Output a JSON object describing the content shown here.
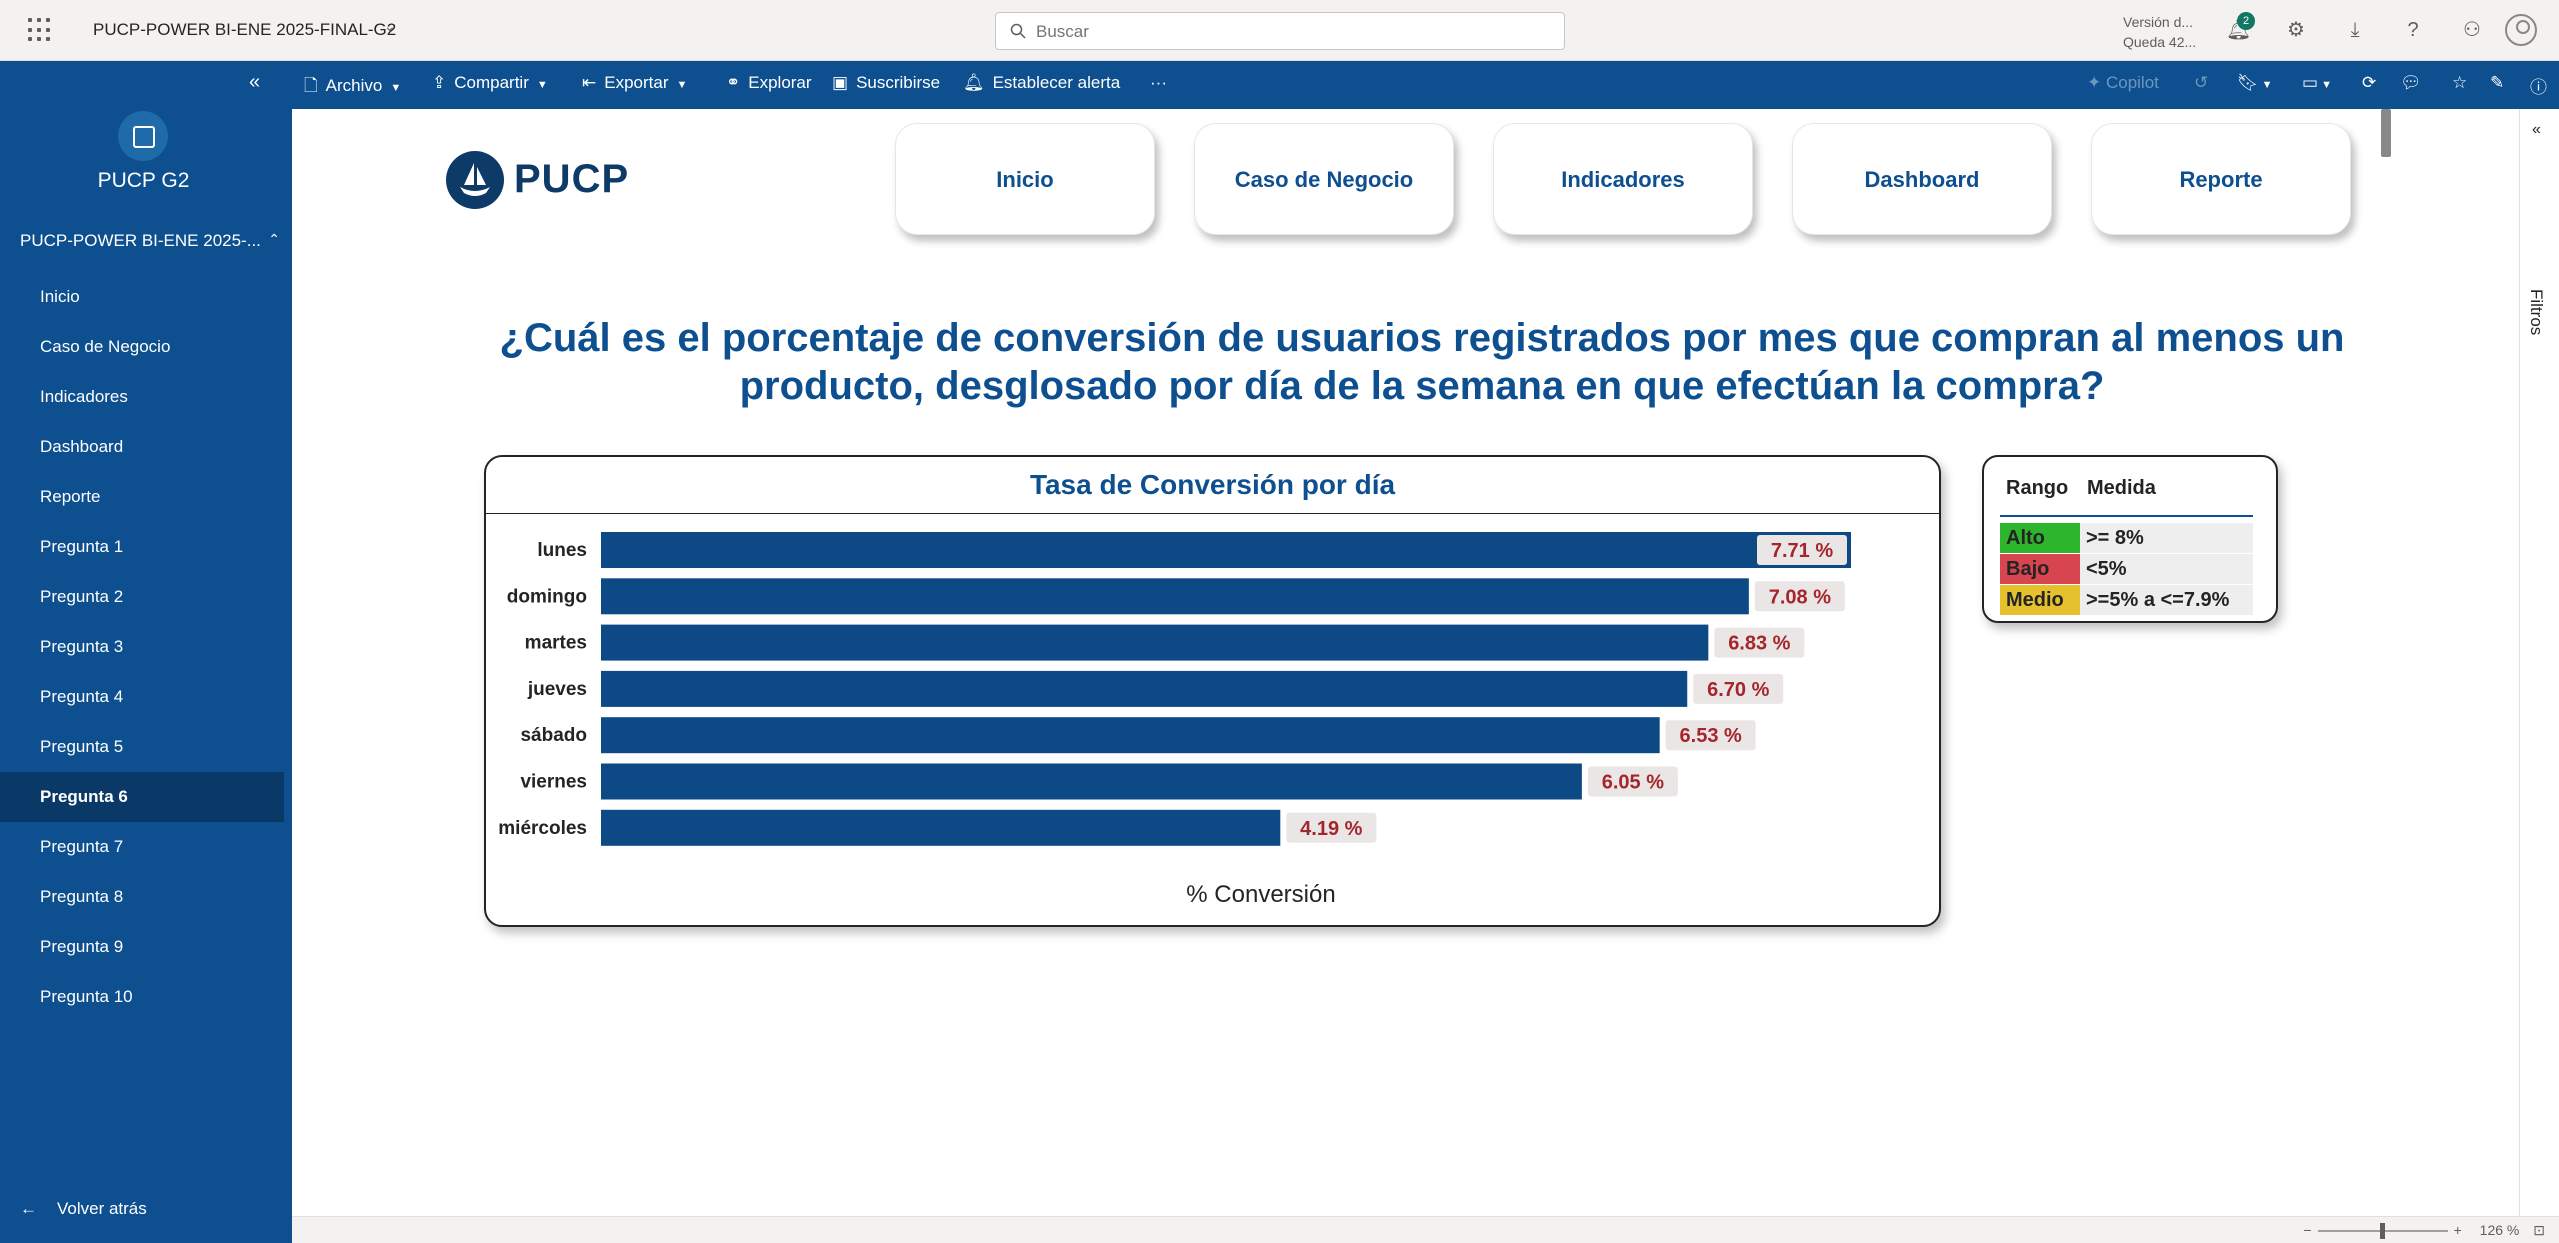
{
  "topbar": {
    "workspace_title": "PUCP-POWER BI-ENE 2025-FINAL-G2",
    "search_placeholder": "Buscar",
    "version_line1": "Versión d...",
    "version_line2": "Queda 42...",
    "notification_count": "2"
  },
  "sidebar": {
    "app_name": "PUCP G2",
    "report_name": "PUCP-POWER BI-ENE 2025-...",
    "items": [
      {
        "label": "Inicio"
      },
      {
        "label": "Caso de Negocio"
      },
      {
        "label": "Indicadores"
      },
      {
        "label": "Dashboard"
      },
      {
        "label": "Reporte"
      },
      {
        "label": "Pregunta 1"
      },
      {
        "label": "Pregunta 2"
      },
      {
        "label": "Pregunta 3"
      },
      {
        "label": "Pregunta 4"
      },
      {
        "label": "Pregunta 5"
      },
      {
        "label": "Pregunta 6",
        "active": true
      },
      {
        "label": "Pregunta 7"
      },
      {
        "label": "Pregunta 8"
      },
      {
        "label": "Pregunta 9"
      },
      {
        "label": "Pregunta 10"
      }
    ],
    "back_label": "Volver atrás"
  },
  "actionbar": {
    "archivo": "Archivo",
    "compartir": "Compartir",
    "exportar": "Exportar",
    "explorar": "Explorar",
    "suscribirse": "Suscribirse",
    "alerta": "Establecer alerta",
    "more": "···",
    "copilot": "Copilot"
  },
  "report": {
    "logo_text": "PUCP",
    "nav_buttons": [
      "Inicio",
      "Caso de Negocio",
      "Indicadores",
      "Dashboard",
      "Reporte"
    ],
    "question": "¿Cuál es el porcentaje de conversión de usuarios registrados por mes que compran al menos un producto, desglosado por día de la semana en que efectúan la compra?",
    "legend": {
      "header_range": "Rango",
      "header_measure": "Medida",
      "rows": [
        {
          "name": "Alto",
          "value": ">= 8%",
          "color": "#2db52d"
        },
        {
          "name": "Bajo",
          "value": "<5%",
          "color": "#d64550"
        },
        {
          "name": "Medio",
          "value": ">=5% a <=7.9%",
          "color": "#e6c12e"
        }
      ]
    }
  },
  "filters_label": "Filtros",
  "zoom_label": "126 %",
  "colors": {
    "brand_blue": "#0d4f8f",
    "bar_blue": "#0d4a85",
    "label_red": "#a4262c",
    "label_bg": "#ebe6e6"
  },
  "chart_data": {
    "type": "bar",
    "orientation": "horizontal",
    "title": "Tasa de Conversión por día",
    "xlabel": "% Conversión",
    "categories": [
      "lunes",
      "domingo",
      "martes",
      "jueves",
      "sábado",
      "viernes",
      "miércoles"
    ],
    "values": [
      7.71,
      7.08,
      6.83,
      6.7,
      6.53,
      6.05,
      4.19
    ],
    "data_labels": [
      "7.71 %",
      "7.08 %",
      "6.83 %",
      "6.70 %",
      "6.53 %",
      "6.05 %",
      "4.19 %"
    ],
    "xlim": [
      0,
      7.71
    ],
    "grid": false
  }
}
